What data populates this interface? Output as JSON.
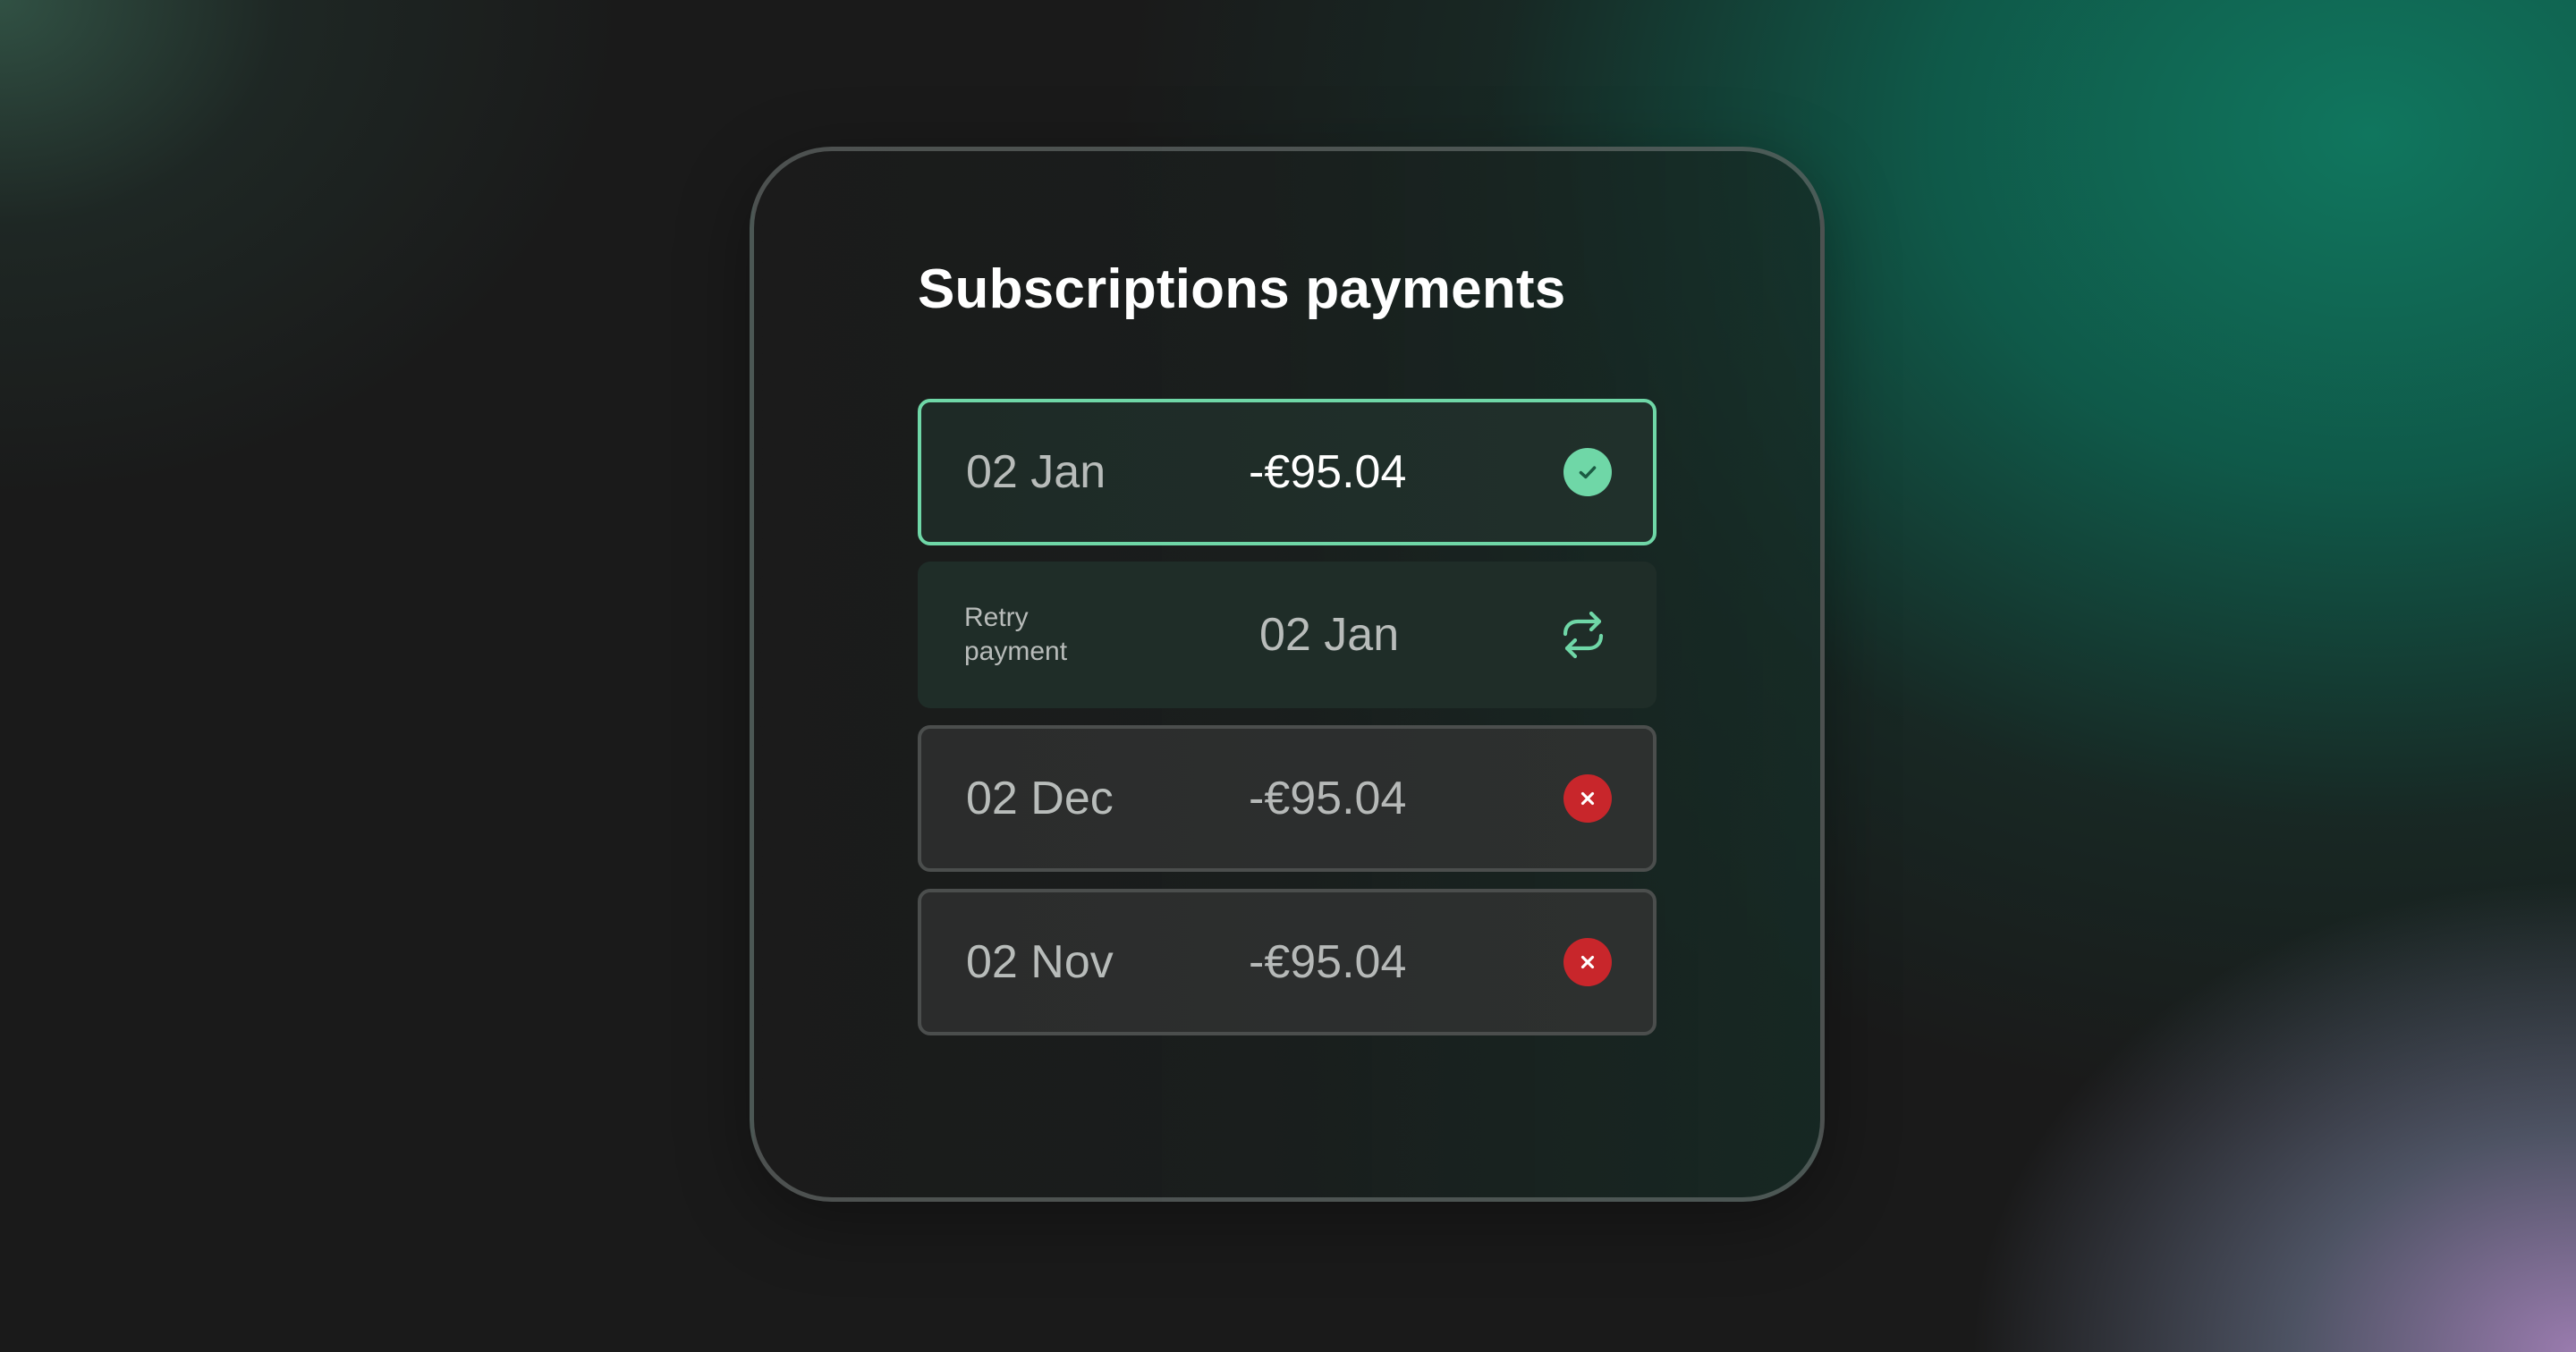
{
  "title": "Subscriptions payments",
  "colors": {
    "success": "#6fd7a7",
    "success_dark": "#1b5b43",
    "failed": "#c8262b",
    "retry": "#6fd7a7"
  },
  "payments": [
    {
      "date": "02 Jan",
      "amount": "-€95.04",
      "status": "success",
      "icon": "check-circle-icon"
    },
    {
      "label_line1": "Retry",
      "label_line2": "payment",
      "date": "02 Jan",
      "status": "retry",
      "icon": "retry-icon"
    },
    {
      "date": "02 Dec",
      "amount": "-€95.04",
      "status": "failed",
      "icon": "x-circle-icon"
    },
    {
      "date": "02 Nov",
      "amount": "-€95.04",
      "status": "failed",
      "icon": "x-circle-icon"
    }
  ]
}
